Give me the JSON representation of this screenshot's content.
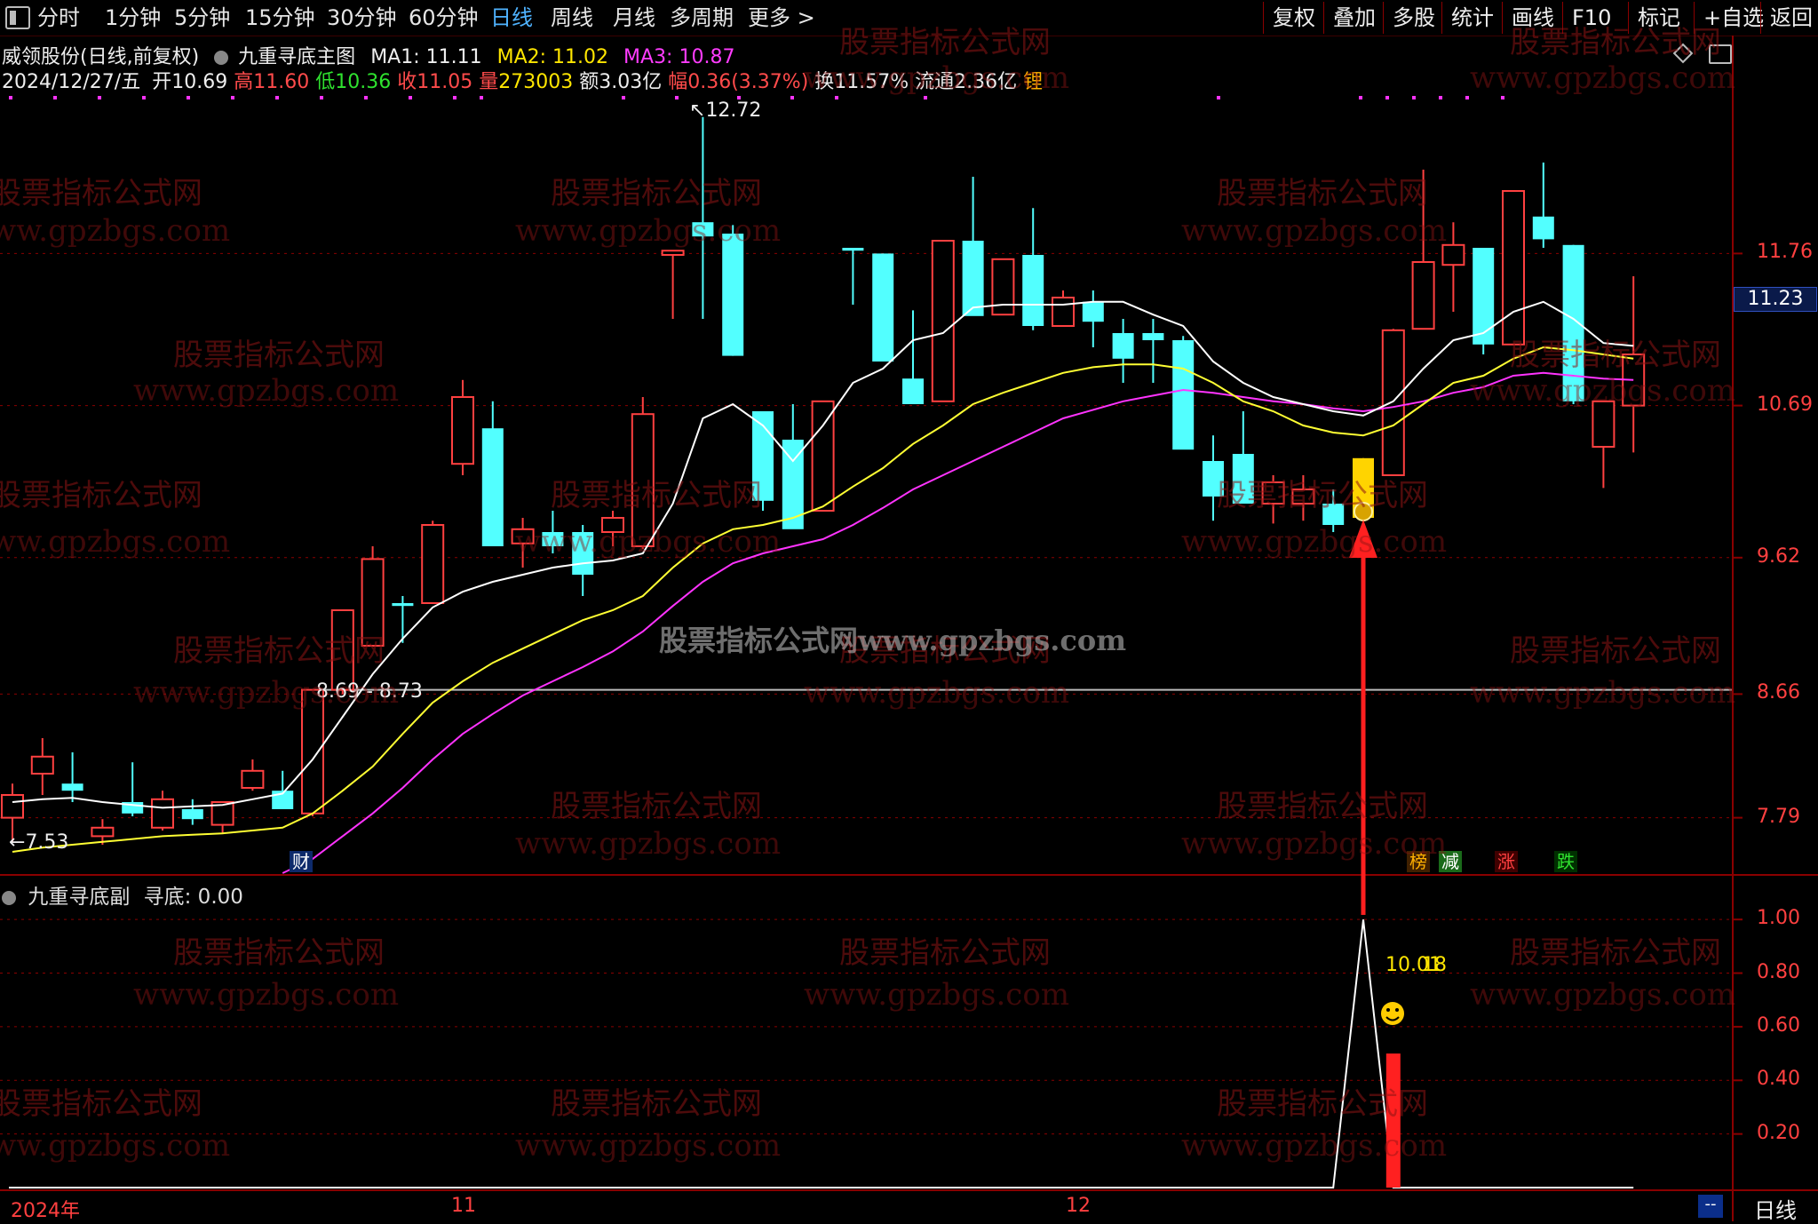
{
  "toolbar": {
    "menu_icon": "panel-toggle-icon",
    "periods": [
      "分时",
      "1分钟",
      "5分钟",
      "15分钟",
      "30分钟",
      "60分钟",
      "日线",
      "周线",
      "月线",
      "多周期",
      "更多 >"
    ],
    "active_period": "日线",
    "right_buttons": [
      "复权",
      "叠加",
      "多股",
      "统计",
      "画线",
      "F10",
      "标记",
      "+自选",
      "返回"
    ]
  },
  "stock_header": {
    "name": "威领股份(日线,前复权)",
    "indicator_name": "九重寻底主图",
    "ma1_label": "MA1: 11.11",
    "ma2_label": "MA2: 11.02",
    "ma3_label": "MA3: 10.87"
  },
  "quote_line": {
    "date": "2024/12/27/五",
    "open_label": "开",
    "open": "10.69",
    "high_label": "高",
    "high": "11.60",
    "low_label": "低",
    "low": "10.36",
    "close_label": "收",
    "close": "11.05",
    "vol_label": "量",
    "vol": "273003",
    "amount": "额3.03亿",
    "change_label": "幅",
    "change": "0.36(3.37%)",
    "turnover": "换11.57%",
    "float_cap": "流通2.36亿",
    "tag": "锂"
  },
  "price_axis": [
    "11.76",
    "10.69",
    "9.62",
    "8.66",
    "7.79"
  ],
  "current_price_tag": "11.23",
  "sub_axis": [
    "1.00",
    "0.80",
    "0.60",
    "0.40",
    "0.20"
  ],
  "annotations": {
    "high_mark": "12.72",
    "low_mark": "7.53",
    "range_label": "8.69 - 8.73",
    "sub_value": "10.01",
    "sub_value_overlap": "18"
  },
  "badges": {
    "cai": "财",
    "bang": "榜",
    "jian": "减",
    "zhang": "涨",
    "die": "跌"
  },
  "sub_chart": {
    "title": "九重寻底副",
    "param": "寻底: 0.00"
  },
  "bottom_axis": {
    "year": "2024年",
    "month1": "11",
    "month2": "12",
    "period_tag": "日线",
    "dash": "--"
  },
  "watermark": {
    "cn": "股票指标公式网",
    "url": "www.gpzbgs.com",
    "center": "股票指标公式网www.gpzbgs.com"
  },
  "colors": {
    "up": "#ff4040",
    "down": "#52ffff",
    "ma1": "#ffffff",
    "ma2": "#ffff33",
    "ma3": "#ff33ff",
    "signal_candle": "#ffd400",
    "arrow": "#ff2020",
    "grid": "#8a0000"
  },
  "chart_data": {
    "type": "candlestick",
    "candles": [
      {
        "o": 7.79,
        "h": 8.03,
        "l": 7.62,
        "c": 7.95
      },
      {
        "o": 8.1,
        "h": 8.35,
        "l": 7.95,
        "c": 8.22
      },
      {
        "o": 8.03,
        "h": 8.25,
        "l": 7.9,
        "c": 7.98
      },
      {
        "o": 7.66,
        "h": 7.78,
        "l": 7.6,
        "c": 7.72
      },
      {
        "o": 7.9,
        "h": 8.18,
        "l": 7.8,
        "c": 7.82
      },
      {
        "o": 7.72,
        "h": 7.98,
        "l": 7.7,
        "c": 7.92
      },
      {
        "o": 7.85,
        "h": 7.92,
        "l": 7.74,
        "c": 7.78
      },
      {
        "o": 7.74,
        "h": 7.88,
        "l": 7.68,
        "c": 7.9
      },
      {
        "o": 8.0,
        "h": 8.2,
        "l": 7.98,
        "c": 8.12
      },
      {
        "o": 7.98,
        "h": 8.12,
        "l": 7.85,
        "c": 7.85
      },
      {
        "o": 7.82,
        "h": 8.15,
        "l": 7.8,
        "c": 8.69
      },
      {
        "o": 8.69,
        "h": 8.92,
        "l": 8.66,
        "c": 9.25
      },
      {
        "o": 9.0,
        "h": 9.7,
        "l": 9.0,
        "c": 9.61
      },
      {
        "o": 9.3,
        "h": 9.35,
        "l": 9.02,
        "c": 9.28
      },
      {
        "o": 9.3,
        "h": 9.88,
        "l": 9.3,
        "c": 9.85
      },
      {
        "o": 10.28,
        "h": 10.87,
        "l": 10.2,
        "c": 10.75
      },
      {
        "o": 10.53,
        "h": 10.72,
        "l": 9.7,
        "c": 9.7
      },
      {
        "o": 9.72,
        "h": 9.9,
        "l": 9.55,
        "c": 9.82
      },
      {
        "o": 9.8,
        "h": 9.95,
        "l": 9.65,
        "c": 9.7
      },
      {
        "o": 9.8,
        "h": 9.85,
        "l": 9.35,
        "c": 9.5
      },
      {
        "o": 9.8,
        "h": 9.95,
        "l": 9.7,
        "c": 9.9
      },
      {
        "o": 9.7,
        "h": 10.75,
        "l": 9.68,
        "c": 10.63
      },
      {
        "o": 11.75,
        "h": 11.75,
        "l": 11.3,
        "c": 11.78
      },
      {
        "o": 11.98,
        "h": 12.72,
        "l": 11.3,
        "c": 11.88
      },
      {
        "o": 11.9,
        "h": 11.96,
        "l": 11.04,
        "c": 11.04
      },
      {
        "o": 10.65,
        "h": 10.65,
        "l": 9.95,
        "c": 10.02
      },
      {
        "o": 10.45,
        "h": 10.7,
        "l": 9.98,
        "c": 9.82
      },
      {
        "o": 9.95,
        "h": 10.72,
        "l": 9.95,
        "c": 10.72
      },
      {
        "o": 11.8,
        "h": 11.8,
        "l": 11.4,
        "c": 11.78
      },
      {
        "o": 11.76,
        "h": 11.76,
        "l": 11.0,
        "c": 11.0
      },
      {
        "o": 10.88,
        "h": 11.36,
        "l": 10.7,
        "c": 10.7
      },
      {
        "o": 10.72,
        "h": 11.85,
        "l": 10.72,
        "c": 11.85
      },
      {
        "o": 11.85,
        "h": 12.3,
        "l": 11.35,
        "c": 11.32
      },
      {
        "o": 11.33,
        "h": 11.72,
        "l": 11.33,
        "c": 11.72
      },
      {
        "o": 11.75,
        "h": 12.08,
        "l": 11.22,
        "c": 11.25
      },
      {
        "o": 11.25,
        "h": 11.5,
        "l": 11.25,
        "c": 11.45
      },
      {
        "o": 11.42,
        "h": 11.5,
        "l": 11.1,
        "c": 11.28
      },
      {
        "o": 11.2,
        "h": 11.3,
        "l": 10.85,
        "c": 11.02
      },
      {
        "o": 11.2,
        "h": 11.3,
        "l": 10.85,
        "c": 11.15
      },
      {
        "o": 11.15,
        "h": 11.18,
        "l": 10.55,
        "c": 10.38
      },
      {
        "o": 10.3,
        "h": 10.48,
        "l": 9.88,
        "c": 10.05
      },
      {
        "o": 10.35,
        "h": 10.65,
        "l": 10.05,
        "c": 10.0
      },
      {
        "o": 10.0,
        "h": 10.2,
        "l": 9.86,
        "c": 10.15
      },
      {
        "o": 10.0,
        "h": 10.2,
        "l": 9.88,
        "c": 10.1
      },
      {
        "o": 10.0,
        "h": 10.1,
        "l": 9.8,
        "c": 9.85
      },
      {
        "o": 9.9,
        "h": 10.32,
        "l": 9.82,
        "c": 10.32
      },
      {
        "o": 10.2,
        "h": 11.23,
        "l": 10.2,
        "c": 11.22
      },
      {
        "o": 11.23,
        "h": 12.35,
        "l": 11.3,
        "c": 11.7
      },
      {
        "o": 11.68,
        "h": 11.98,
        "l": 11.35,
        "c": 11.82
      },
      {
        "o": 11.8,
        "h": 11.8,
        "l": 11.05,
        "c": 11.12
      },
      {
        "o": 11.12,
        "h": 12.2,
        "l": 11.12,
        "c": 12.2
      },
      {
        "o": 12.02,
        "h": 12.4,
        "l": 11.8,
        "c": 11.86
      },
      {
        "o": 11.82,
        "h": 11.82,
        "l": 10.7,
        "c": 10.72
      },
      {
        "o": 10.4,
        "h": 10.72,
        "l": 10.11,
        "c": 10.72
      },
      {
        "o": 10.69,
        "h": 11.6,
        "l": 10.36,
        "c": 11.05
      }
    ],
    "ma1": [
      7.9,
      7.92,
      7.93,
      7.9,
      7.88,
      7.86,
      7.87,
      7.88,
      7.92,
      7.96,
      8.2,
      8.5,
      8.8,
      9.05,
      9.27,
      9.38,
      9.45,
      9.5,
      9.55,
      9.58,
      9.6,
      9.65,
      10.0,
      10.6,
      10.7,
      10.55,
      10.3,
      10.55,
      10.85,
      10.95,
      11.15,
      11.2,
      11.38,
      11.4,
      11.4,
      11.4,
      11.42,
      11.42,
      11.33,
      11.25,
      11.0,
      10.85,
      10.75,
      10.7,
      10.65,
      10.62,
      10.72,
      10.95,
      11.15,
      11.2,
      11.35,
      11.42,
      11.3,
      11.13,
      11.11
    ],
    "ma2": [
      7.55,
      7.58,
      7.6,
      7.62,
      7.64,
      7.66,
      7.67,
      7.68,
      7.7,
      7.72,
      7.82,
      7.98,
      8.15,
      8.38,
      8.6,
      8.75,
      8.88,
      8.98,
      9.08,
      9.18,
      9.25,
      9.35,
      9.55,
      9.72,
      9.82,
      9.85,
      9.9,
      9.98,
      10.12,
      10.25,
      10.42,
      10.55,
      10.7,
      10.78,
      10.85,
      10.92,
      10.96,
      10.98,
      10.98,
      10.95,
      10.85,
      10.72,
      10.65,
      10.55,
      10.5,
      10.48,
      10.55,
      10.7,
      10.85,
      10.9,
      11.02,
      11.1,
      11.08,
      11.05,
      11.02
    ],
    "ma3": [
      null,
      null,
      null,
      null,
      null,
      null,
      null,
      null,
      null,
      7.4,
      7.5,
      7.66,
      7.82,
      8.0,
      8.2,
      8.38,
      8.52,
      8.65,
      8.75,
      8.85,
      8.96,
      9.1,
      9.28,
      9.45,
      9.58,
      9.65,
      9.7,
      9.75,
      9.85,
      9.97,
      10.1,
      10.2,
      10.3,
      10.4,
      10.5,
      10.6,
      10.66,
      10.72,
      10.76,
      10.8,
      10.78,
      10.75,
      10.72,
      10.7,
      10.67,
      10.65,
      10.68,
      10.72,
      10.78,
      10.82,
      10.9,
      10.92,
      10.9,
      10.88,
      10.87
    ],
    "price_range": [
      7.45,
      12.95
    ],
    "signal_index": 45,
    "sub_series": [
      0,
      0,
      0,
      0,
      0,
      0,
      0,
      0,
      0,
      0,
      0,
      0,
      0,
      0,
      0,
      0,
      0,
      0,
      0,
      0,
      0,
      0,
      0,
      0,
      0,
      0,
      0,
      0,
      0,
      0,
      0,
      0,
      0,
      0,
      0,
      0,
      0,
      0,
      0,
      0,
      0,
      0,
      0,
      0,
      0,
      1.0,
      0,
      0,
      0,
      0,
      0,
      0,
      0,
      0,
      0
    ],
    "sub_bar": {
      "index": 46,
      "value": 0.5
    },
    "sub_range": [
      0,
      1.1
    ]
  }
}
